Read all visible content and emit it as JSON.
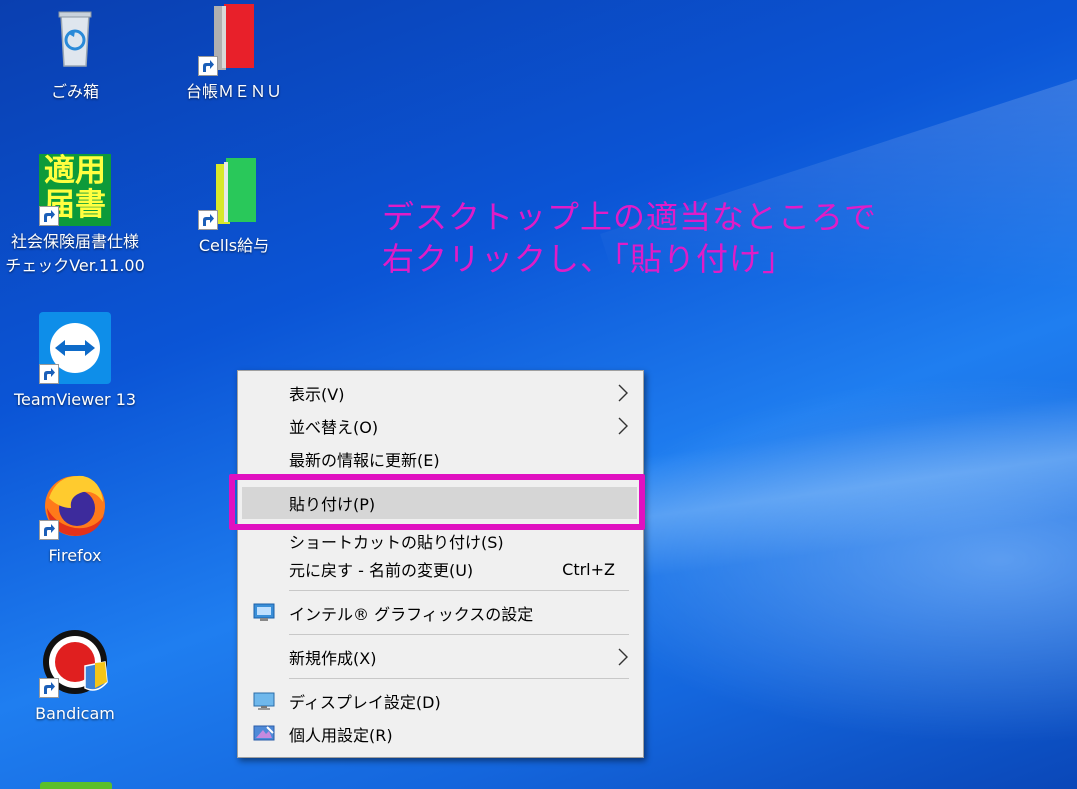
{
  "annotation": {
    "line1": "デスクトップ上の適当なところで",
    "line2": "右クリックし、「貼り付け」",
    "color": "#e01cc7"
  },
  "desktop_icons": [
    {
      "label": "ごみ箱",
      "icon": "recycle-bin-icon"
    },
    {
      "label": "台帳ＭＥＮＵ",
      "icon": "red-book-icon"
    },
    {
      "label_line1": "社会保険届書仕様",
      "label_line2": "チェックVer.11.00",
      "icon": "tekiyou-todokesho-icon",
      "icon_text": "適用届書"
    },
    {
      "label": "Cells給与",
      "icon": "green-book-icon"
    },
    {
      "label": "TeamViewer 13",
      "icon": "teamviewer-icon"
    },
    {
      "label": "Firefox",
      "icon": "firefox-icon"
    },
    {
      "label": "Bandicam",
      "icon": "bandicam-icon"
    }
  ],
  "context_menu": {
    "items": [
      {
        "label": "表示(V)",
        "submenu": true
      },
      {
        "label": "並べ替え(O)",
        "submenu": true
      },
      {
        "label": "最新の情報に更新(E)"
      },
      {
        "label": "貼り付け(P)",
        "highlighted": true
      },
      {
        "label": "ショートカットの貼り付け(S)"
      },
      {
        "label": "元に戻す - 名前の変更(U)",
        "shortcut": "Ctrl+Z"
      },
      {
        "label": "インテル® グラフィックスの設定",
        "icon": "intel-graphics-icon"
      },
      {
        "label": "新規作成(X)",
        "submenu": true
      },
      {
        "label": "ディスプレイ設定(D)",
        "icon": "display-settings-icon"
      },
      {
        "label": "個人用設定(R)",
        "icon": "personalize-icon"
      }
    ]
  }
}
